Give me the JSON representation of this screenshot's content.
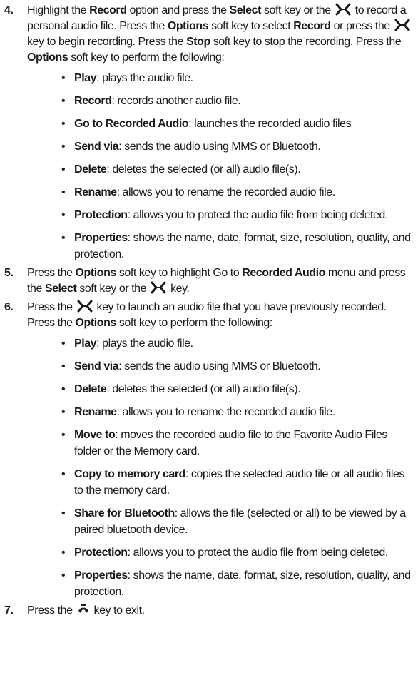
{
  "steps": [
    {
      "number": "4.",
      "t1": "Highlight the ",
      "b1": "Record",
      "t2": " option and press the ",
      "b2": "Select",
      "t3": " soft key or the ",
      "t4": " to record a personal audio file. Press the ",
      "b3": "Options",
      "t5": " soft key to select ",
      "b4": "Record",
      "t6": " or press the ",
      "t7": " key to begin recording.  Press the ",
      "b5": "Stop",
      "t8": " soft key to stop the recording. Press the ",
      "b6": "Options",
      "t9": " soft key to perform the following:",
      "items": [
        {
          "term": "Play",
          "desc": ": plays the audio file."
        },
        {
          "term": "Record",
          "desc": ": records another audio file."
        },
        {
          "term": "Go to Recorded Audio",
          "desc": ": launches the recorded audio files"
        },
        {
          "term": "Send via",
          "desc": ": sends the audio using MMS or Bluetooth."
        },
        {
          "term": "Delete",
          "desc": ": deletes the selected (or all) audio file(s)."
        },
        {
          "term": "Rename",
          "desc": ": allows you to rename the recorded audio file."
        },
        {
          "term": "Protection",
          "desc": ": allows you to protect the audio file from being deleted."
        },
        {
          "term": "Properties",
          "desc": ": shows the name, date, format, size, resolution, quality, and protection."
        }
      ]
    },
    {
      "number": "5.",
      "t1": "Press the ",
      "b1": "Options",
      "t2": " soft key to highlight Go to ",
      "b2": "Recorded Audio",
      "t3": " menu and press the ",
      "b3": "Select",
      "t4": " soft key or the ",
      "t5": " key."
    },
    {
      "number": "6.",
      "t1": "Press the ",
      "t2": " key to launch an audio file that you have previously recorded. Press the ",
      "b1": "Options",
      "t3": " soft key to perform the following:",
      "items": [
        {
          "term": "Play",
          "desc": ": plays the audio file."
        },
        {
          "term": "Send via",
          "desc": ": sends the audio using MMS or Bluetooth."
        },
        {
          "term": "Delete",
          "desc": ": deletes the selected (or all) audio file(s)."
        },
        {
          "term": "Rename",
          "desc": ": allows you to rename the recorded audio file."
        },
        {
          "term": "Move to",
          "desc": ": moves the recorded audio file to the Favorite Audio Files folder or the Memory card."
        },
        {
          "term": "Copy to memory card",
          "desc": ": copies the selected audio file or all audio files to the memory card."
        },
        {
          "term": "Share for Bluetooth",
          "desc": ": allows the file (selected or all) to be viewed by a paired bluetooth device."
        },
        {
          "term": "Protection",
          "desc": ": allows you to protect the audio file from being deleted."
        },
        {
          "term": "Properties",
          "desc": ": shows the name, date, format, size, resolution, quality, and protection."
        }
      ]
    },
    {
      "number": "7.",
      "t1": "Press the ",
      "t2": " key to exit."
    }
  ],
  "icons": {
    "select_key": "select-key-x-icon",
    "end_key": "end-call-key-icon"
  },
  "colors": {
    "text": "#1a1a1a"
  }
}
